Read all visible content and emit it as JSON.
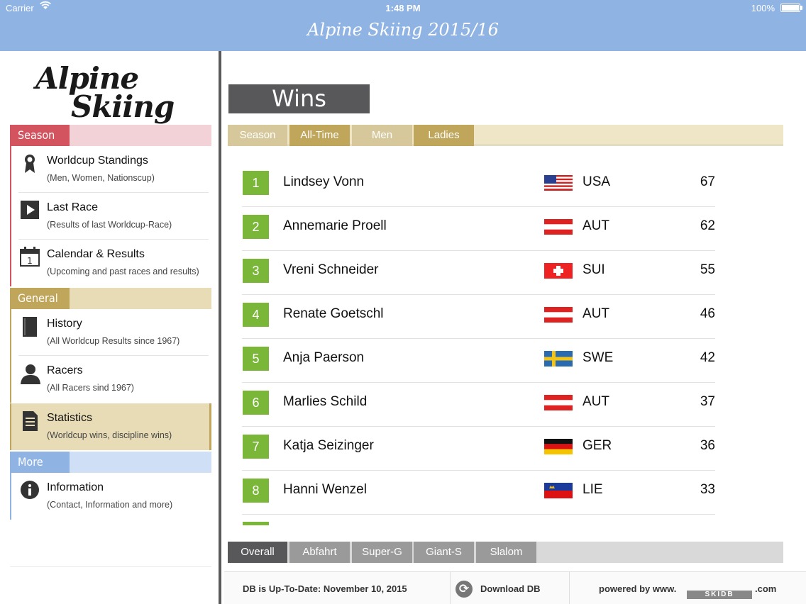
{
  "status": {
    "carrier": "Carrier",
    "time": "1:48 PM",
    "battery": "100%"
  },
  "app": {
    "title": "Alpine Skiing 2015/16"
  },
  "logo": {
    "line1": "Alpine",
    "line2": "Skiing"
  },
  "sidebar": {
    "sections": {
      "season": "Season",
      "general": "General",
      "more": "More"
    },
    "items": [
      {
        "title": "Worldcup Standings",
        "subtitle": "(Men, Women, Nationscup)",
        "icon": "award-ribbon-icon"
      },
      {
        "title": "Last Race",
        "subtitle": "(Results of last Worldcup-Race)",
        "icon": "play-icon"
      },
      {
        "title": "Calendar & Results",
        "subtitle": "(Upcoming and past races and results)",
        "icon": "calendar-icon"
      },
      {
        "title": "History",
        "subtitle": "(All Worldcup Results since 1967)",
        "icon": "book-icon"
      },
      {
        "title": "Racers",
        "subtitle": "(All Racers sind 1967)",
        "icon": "person-icon"
      },
      {
        "title": "Statistics",
        "subtitle": "(Worldcup wins, discipline wins)",
        "icon": "document-icon"
      },
      {
        "title": "Information",
        "subtitle": "(Contact, Information and more)",
        "icon": "info-icon"
      }
    ]
  },
  "main": {
    "heading": "Wins",
    "top_tabs": [
      "Season",
      "All-Time",
      "Men",
      "Ladies"
    ],
    "bottom_tabs": [
      "Overall",
      "Abfahrt",
      "Super-G",
      "Giant-S",
      "Slalom"
    ],
    "rows": [
      {
        "rank": "1",
        "name": "Lindsey Vonn",
        "nation": "USA",
        "wins": "67"
      },
      {
        "rank": "2",
        "name": "Annemarie Proell",
        "nation": "AUT",
        "wins": "62"
      },
      {
        "rank": "3",
        "name": "Vreni Schneider",
        "nation": "SUI",
        "wins": "55"
      },
      {
        "rank": "4",
        "name": "Renate Goetschl",
        "nation": "AUT",
        "wins": "46"
      },
      {
        "rank": "5",
        "name": "Anja Paerson",
        "nation": "SWE",
        "wins": "42"
      },
      {
        "rank": "6",
        "name": "Marlies Schild",
        "nation": "AUT",
        "wins": "37"
      },
      {
        "rank": "7",
        "name": "Katja Seizinger",
        "nation": "GER",
        "wins": "36"
      },
      {
        "rank": "8",
        "name": "Hanni Wenzel",
        "nation": "LIE",
        "wins": "33"
      }
    ]
  },
  "footer": {
    "db_status": "DB is Up-To-Date: November 10, 2015",
    "download": "Download DB",
    "powered": "powered by www.",
    "brand": "SKIDB",
    "tld": ".com"
  },
  "colors": {
    "navbar": "#8fb3e3",
    "season": "#d3545f",
    "general": "#bfa65a",
    "more": "#8fb3e3",
    "rank_green": "#7ab738",
    "heading_bg": "#58585a"
  }
}
